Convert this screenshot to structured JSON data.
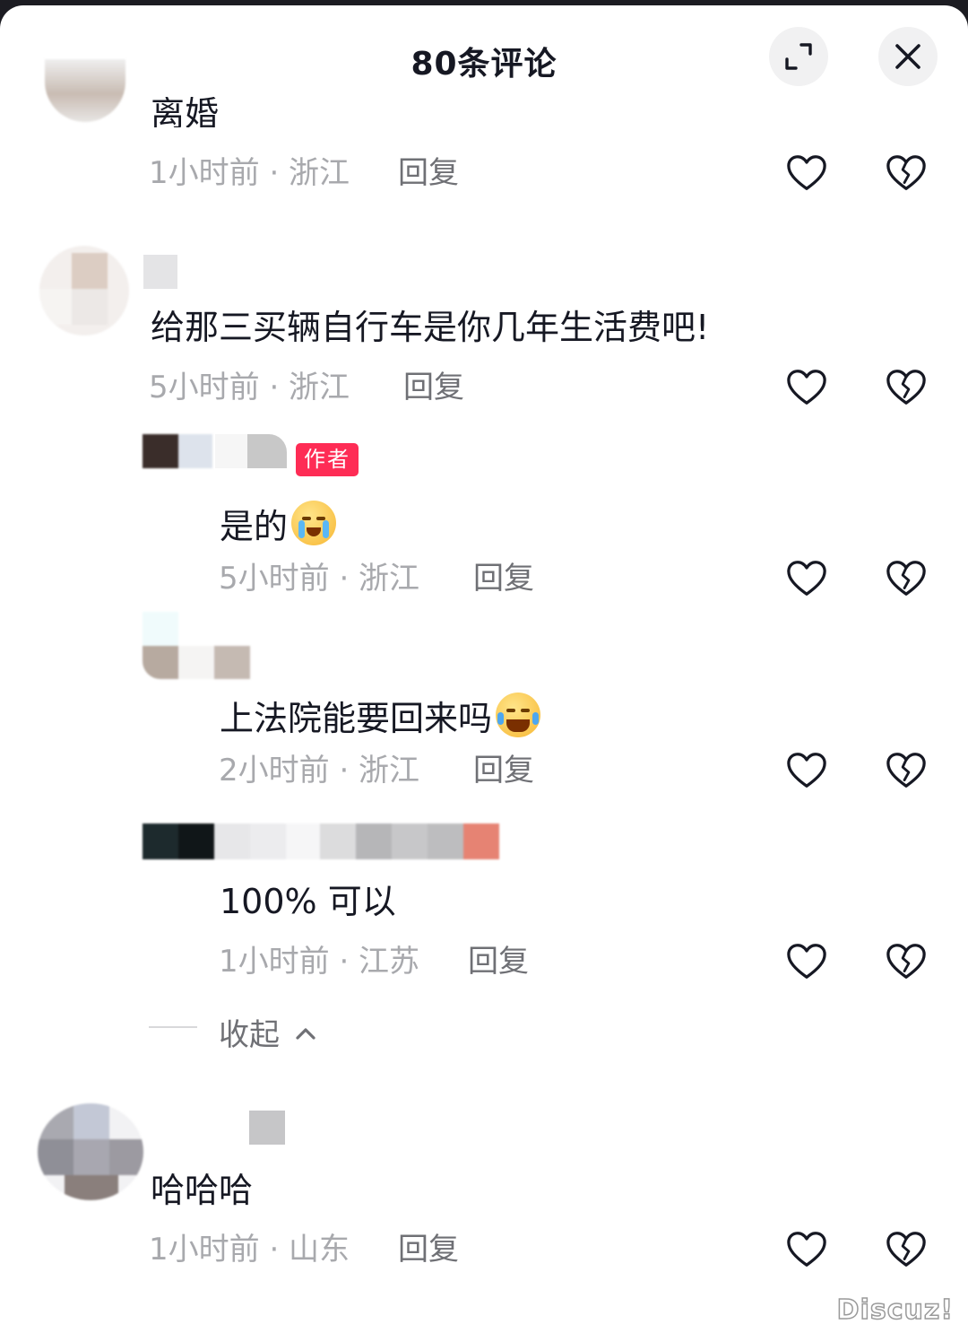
{
  "header": {
    "title": "80条评论"
  },
  "comments": [
    {
      "text": "离婚",
      "meta": "1小时前 · 浙江",
      "reply": "回复"
    },
    {
      "text": "给那三买辆自行车是你几年生活费吧!",
      "meta": "5小时前 · 浙江",
      "reply": "回复",
      "replies": [
        {
          "badge": "作者",
          "text": "是的",
          "emoji": "crying-face-emoji",
          "meta": "5小时前 · 浙江",
          "reply": "回复"
        },
        {
          "text": "上法院能要回来吗",
          "emoji": "laughing-tears-emoji",
          "meta": "2小时前 · 浙江",
          "reply": "回复"
        },
        {
          "text": "100% 可以",
          "meta": "1小时前 · 江苏",
          "reply": "回复"
        }
      ],
      "collapse": "收起"
    },
    {
      "text": "哈哈哈",
      "meta": "1小时前 · 山东",
      "reply": "回复"
    }
  ],
  "icons": {
    "expand": "expand-icon",
    "close": "close-icon",
    "like": "heart-icon",
    "dislike": "broken-heart-icon"
  },
  "watermark": "Discuz!",
  "colors": {
    "badge": "#fe2c55",
    "meta": "#a8a9ad",
    "text": "#161823"
  }
}
